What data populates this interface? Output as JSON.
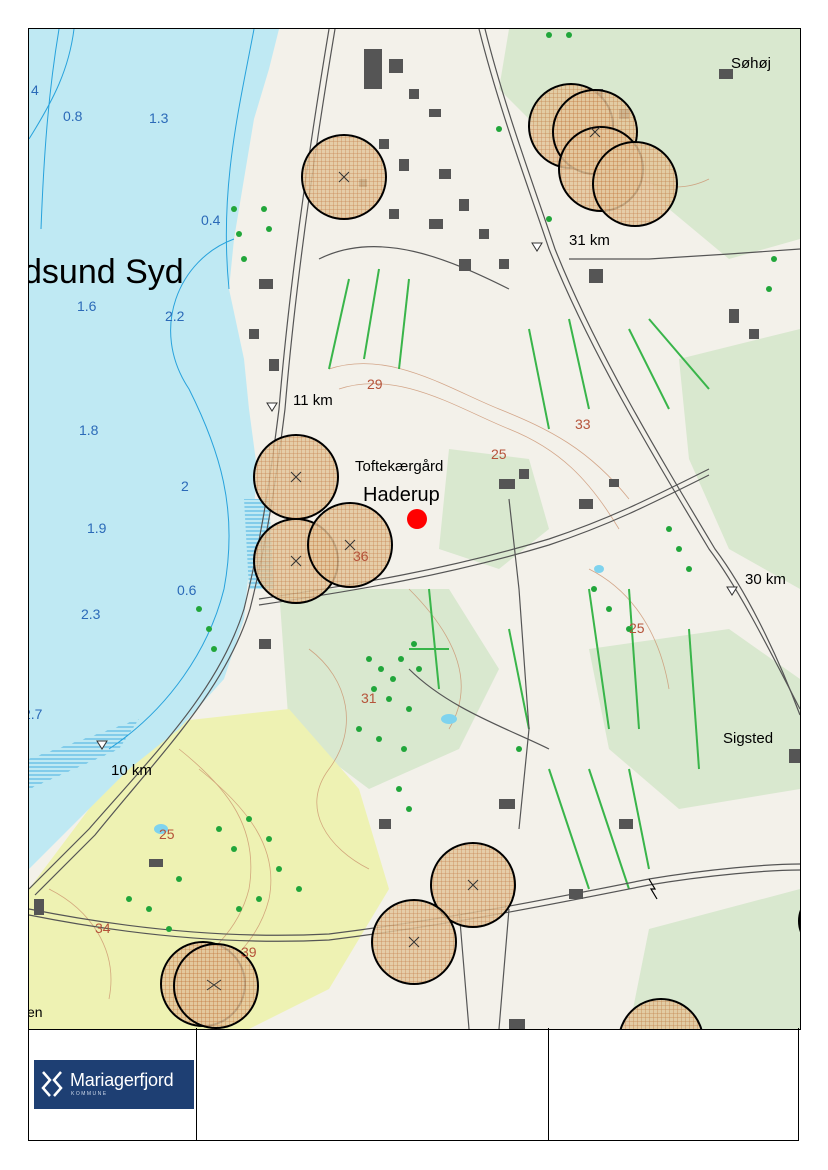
{
  "map": {
    "place_labels": {
      "region": "dsund Syd",
      "farm": "Toftekærgård",
      "village": "Haderup",
      "north_east": "Søhøj",
      "east": "Sigsted",
      "bottom_left": "en"
    },
    "distance_markers": [
      "31 km",
      "11 km",
      "30 km",
      "10 km"
    ],
    "water_depths": [
      "0.8",
      "1.3",
      "0.4",
      "1.6",
      "2.2",
      "1.8",
      "2",
      "1.9",
      "0.6",
      "2.3",
      "2.7",
      "4"
    ],
    "elevations": [
      "29",
      "33",
      "25",
      "36",
      "31",
      "25",
      "34",
      "39",
      "25"
    ],
    "colors": {
      "water": "#bfe9f3",
      "land": "#f3f1ea",
      "forest": "#d9e8cf",
      "dune": "#eef2b3",
      "contour": "#c98e6a",
      "buffer_fill": "#d9b48a",
      "marker": "#ff0000"
    },
    "icons": [
      "buffer-zone-circle",
      "location-marker",
      "north-arrow-icon"
    ]
  },
  "footer": {
    "logo_name": "Mariagerfjord",
    "logo_sub": "KOMMUNE",
    "middle_text": "",
    "right_text": ""
  }
}
